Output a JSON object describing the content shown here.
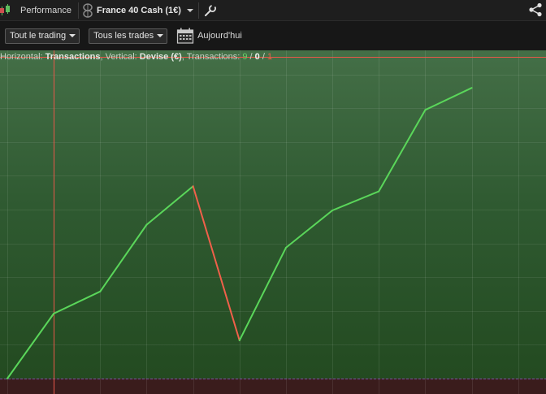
{
  "topbar": {
    "performance_label": "Performance",
    "instrument_label": "France 40 Cash (1€)",
    "icons": [
      "candlestick-icon",
      "coin-icon",
      "wrench-icon",
      "share-icon"
    ]
  },
  "toolbar": {
    "trading_filter": "Tout le trading",
    "trades_filter": "Tous les trades",
    "today_label": "Aujourd'hui",
    "icons": [
      "calendar-icon"
    ]
  },
  "chart_info": {
    "horizontal_prefix": "Horizontal: ",
    "horizontal_value": "Transactions",
    "vertical_prefix": ", Vertical: ",
    "vertical_value": "Devise (€)",
    "transactions_prefix": ", Transactions: ",
    "count_win": "9",
    "sep1": " / ",
    "count_even": "0",
    "sep2": " / ",
    "count_loss": "1"
  },
  "colors": {
    "gain_line": "#5ad65a",
    "loss_line": "#f0604a",
    "cursor_line": "#e8574a",
    "chart_bg_top": "#446f47",
    "chart_bg_bottom": "#22491f"
  },
  "chart_data": {
    "type": "line",
    "xlabel": "Transactions",
    "ylabel": "Devise (€)",
    "x": [
      0,
      1,
      2,
      3,
      4,
      5,
      6,
      7,
      8,
      9,
      10
    ],
    "y": [
      0,
      21.8,
      29.2,
      51.6,
      64.5,
      12.8,
      43.9,
      56.4,
      62.8,
      90.1,
      97.5
    ],
    "segment_result": [
      "gain",
      "gain",
      "gain",
      "gain",
      "loss",
      "gain",
      "gain",
      "gain",
      "gain",
      "gain"
    ],
    "ylim": [
      0,
      100
    ],
    "xlim": [
      0,
      11.6
    ],
    "grid": true,
    "cursor_x": 1
  }
}
